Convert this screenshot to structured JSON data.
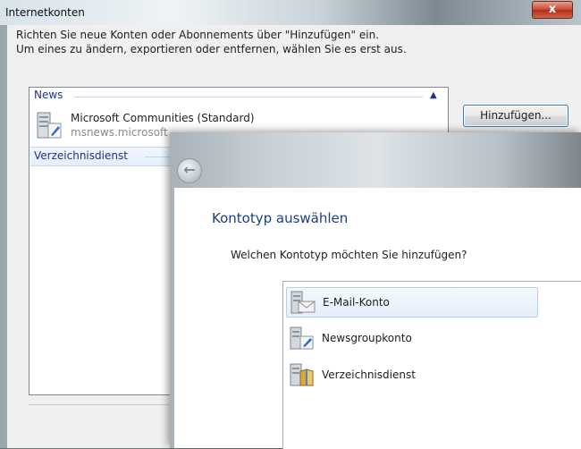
{
  "window": {
    "title": "Internetkonten",
    "close_label": "x"
  },
  "intro": {
    "line1": "Richten Sie neue Konten oder Abonnements über \"Hinzufügen\" ein.",
    "line2": "Um eines zu ändern, exportieren oder entfernen, wählen Sie es erst aus."
  },
  "accounts": {
    "groups": [
      {
        "label": "News",
        "collapse_icon": "▲"
      },
      {
        "label": "Verzeichnisdienst"
      }
    ],
    "items": [
      {
        "name": "Microsoft Communities (Standard)",
        "server": "msnews.microsoft",
        "icon": "newsgroup-icon"
      }
    ]
  },
  "buttons": {
    "add_label": "Hinzufügen..."
  },
  "dialog": {
    "back_icon": "←",
    "title": "Kontotyp auswählen",
    "question": "Welchen Kontotyp möchten Sie hinzufügen?",
    "options": [
      {
        "label": "E-Mail-Konto",
        "icon": "mail-account-icon",
        "selected": true
      },
      {
        "label": "Newsgroupkonto",
        "icon": "newsgroup-account-icon",
        "selected": false
      },
      {
        "label": "Verzeichnisdienst",
        "icon": "directory-service-icon",
        "selected": false
      }
    ]
  },
  "colors": {
    "group_header": "#1e3287",
    "dialog_title": "#1a3e8a",
    "selection": "#e4eefa",
    "close_button": "#c84530"
  }
}
